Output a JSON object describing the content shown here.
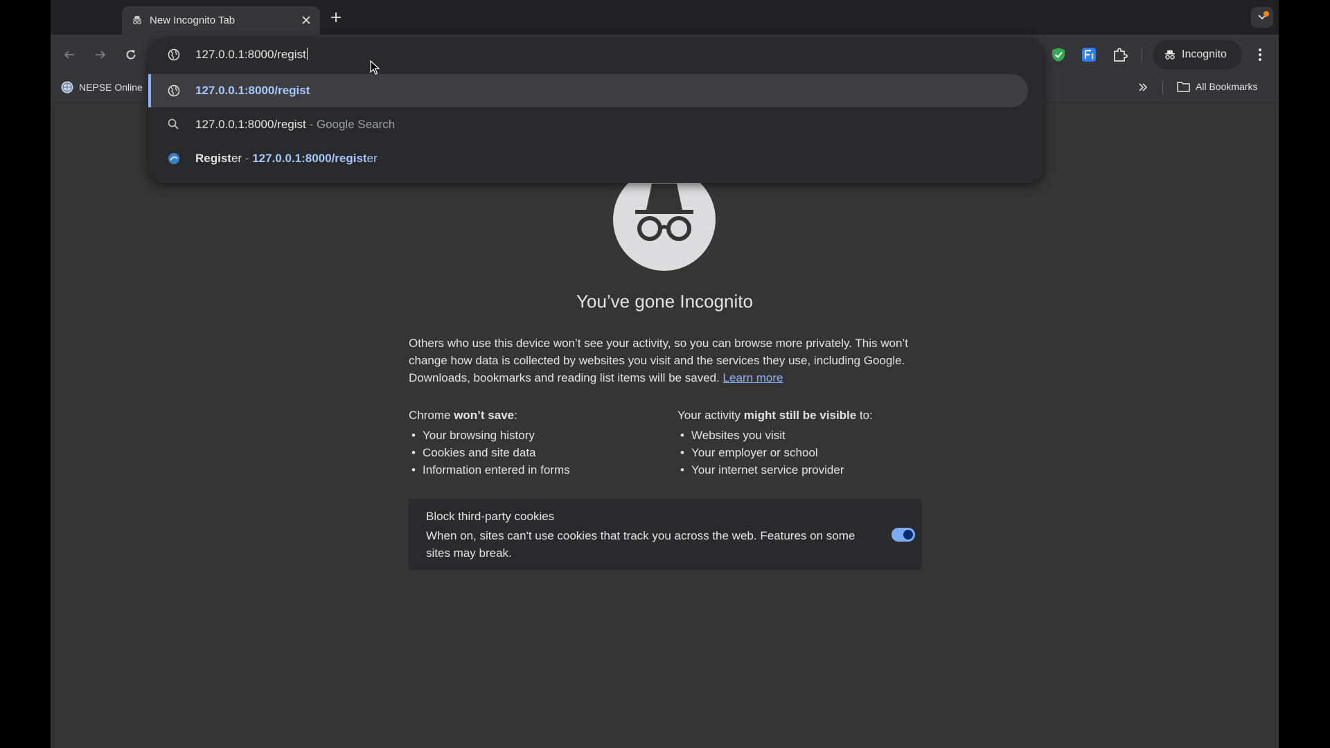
{
  "colors": {
    "tab_strip": "#202124",
    "toolbar": "#35363a",
    "page_bg": "#353535",
    "omnibox_bg": "#282a2d",
    "accent": "#8ab4f8",
    "toggle_on": "#7cacf8",
    "notification_dot": "#f28b00"
  },
  "tab": {
    "title": "New Incognito Tab",
    "icon": "incognito-icon"
  },
  "toolbar": {
    "back_icon": "back-arrow-icon",
    "forward_icon": "forward-arrow-icon",
    "reload_icon": "reload-icon",
    "extensions": [
      "shield-extension-icon",
      "translate-extension-icon",
      "puzzle-extensions-icon"
    ],
    "incognito_label": "Incognito",
    "menu_icon": "three-dots-menu-icon"
  },
  "bookmarks": {
    "item_label": "NEPSE Online",
    "all_bookmarks_label": "All Bookmarks"
  },
  "omnibox": {
    "typed_value": "127.0.0.1:8000/regist",
    "suggestions": [
      {
        "type": "url",
        "text": "127.0.0.1:8000/regist",
        "icon": "globe-icon"
      },
      {
        "type": "search",
        "text": "127.0.0.1:8000/regist",
        "suffix": " - Google Search",
        "icon": "search-icon"
      },
      {
        "type": "history",
        "title_bold": "Regist",
        "title_rest": "er",
        "separator": " - ",
        "url_bold": "127.0.0.1:8000/regist",
        "url_rest": "er",
        "icon": "site-favicon"
      }
    ]
  },
  "ntp": {
    "title": "You’ve gone Incognito",
    "body": "Others who use this device won’t see your activity, so you can browse more privately. This won’t change how data is collected by websites you visit and the services they use, including Google. Downloads, bookmarks and reading list items will be saved. ",
    "learn_more": "Learn more",
    "wont_save": {
      "heading_pre": "Chrome ",
      "heading_bold": "won’t save",
      "heading_post": ":",
      "items": [
        "Your browsing history",
        "Cookies and site data",
        "Information entered in forms"
      ]
    },
    "might_be_visible": {
      "heading_pre": "Your activity ",
      "heading_bold": "might still be visible",
      "heading_post": " to:",
      "items": [
        "Websites you visit",
        "Your employer or school",
        "Your internet service provider"
      ]
    },
    "cookies": {
      "title": "Block third-party cookies",
      "description": "When on, sites can't use cookies that track you across the web. Features on some sites may break.",
      "enabled": true
    }
  }
}
